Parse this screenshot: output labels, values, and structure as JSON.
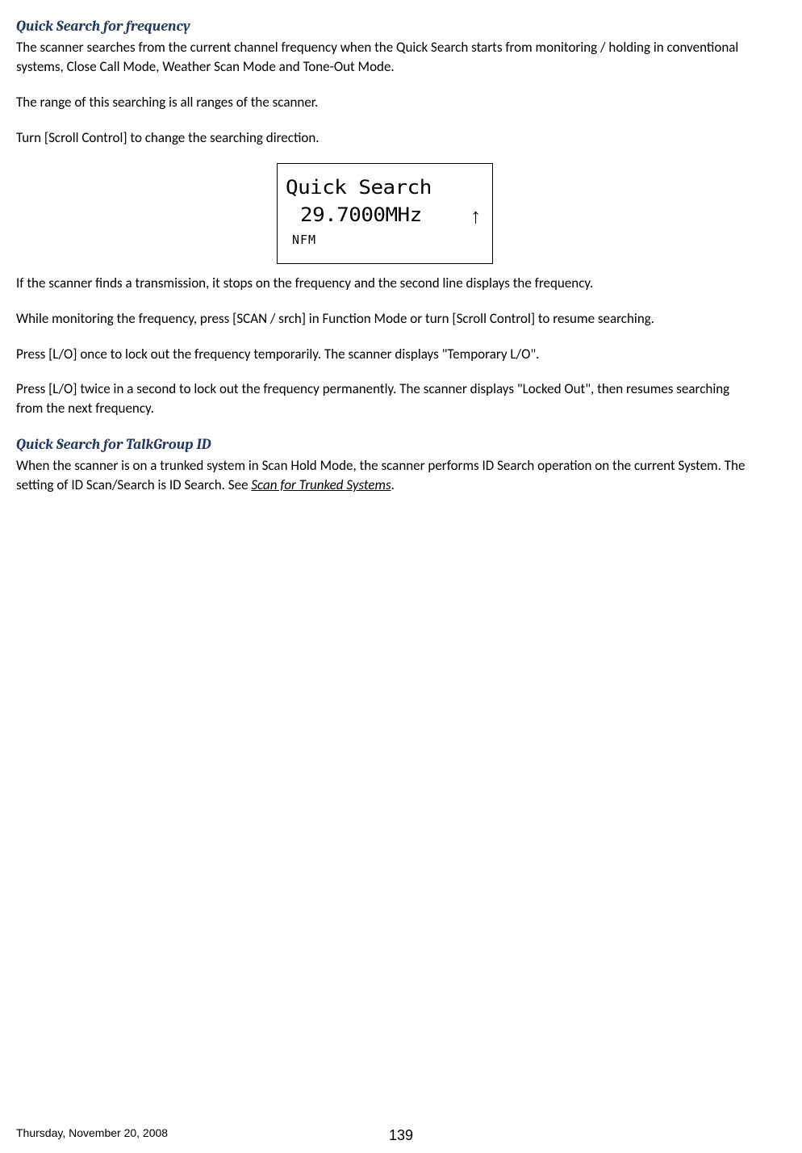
{
  "section1": {
    "heading": "Quick Search for frequency",
    "p1": "The scanner searches from the current channel frequency when the Quick Search starts from monitoring / holding in conventional systems, Close Call Mode, Weather Scan Mode and Tone-Out Mode.",
    "p2": "The range of this searching is all ranges of the scanner.",
    "p3": "Turn [Scroll Control] to change the searching direction.",
    "p4": "If the scanner finds a transmission, it stops on the frequency and the second line displays the frequency.",
    "p5": "While monitoring the frequency, press [SCAN / srch] in Function Mode or turn [Scroll Control] to resume searching.",
    "p6": "Press [L/O] once to lock out the frequency temporarily. The scanner displays \"Temporary L/O\".",
    "p7": "Press [L/O] twice in a second to lock out the frequency permanently. The scanner displays \"Locked Out\", then resumes searching from the next frequency."
  },
  "lcd": {
    "line1": "Quick Search",
    "line2": "29.7000MHz",
    "arrow": "↑",
    "line3": "NFM"
  },
  "section2": {
    "heading": "Quick Search for TalkGroup ID",
    "p1_prefix": "When the scanner is on a trunked system in Scan Hold Mode, the scanner performs ID Search operation on the current System. The setting of ID Scan/Search is ID Search. See ",
    "p1_link": "Scan for Trunked Systems",
    "p1_suffix": "."
  },
  "footer": {
    "date": "Thursday, November 20, 2008",
    "page": "139"
  }
}
